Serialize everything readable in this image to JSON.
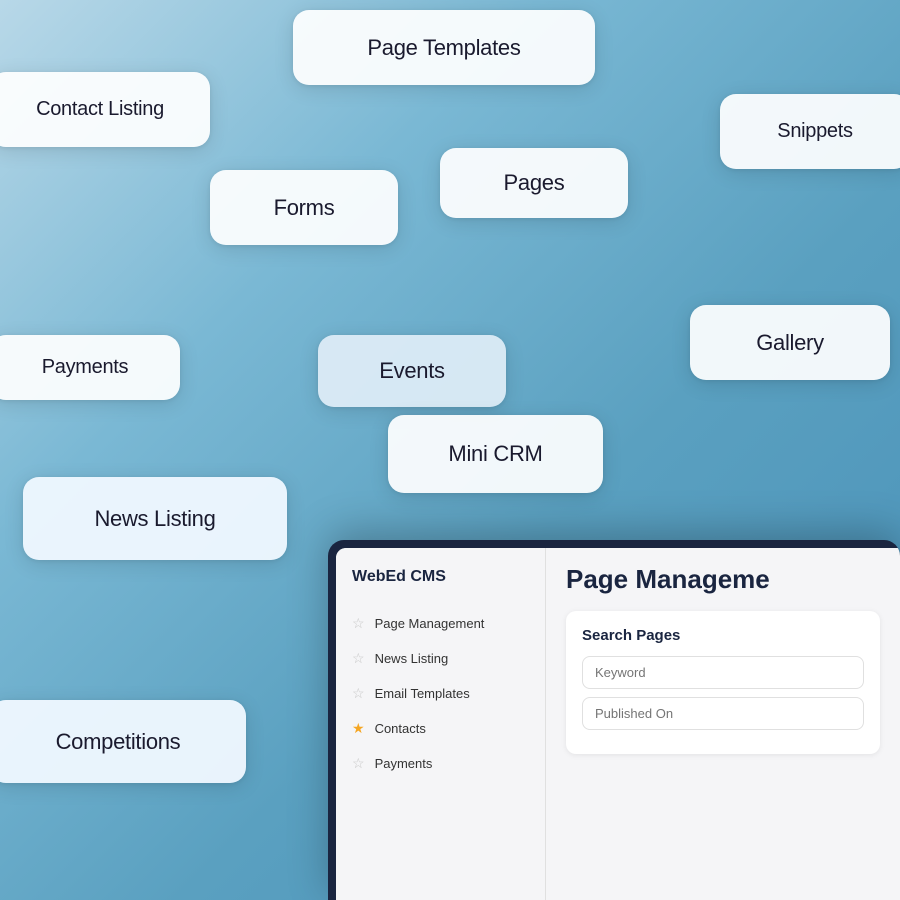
{
  "background": {
    "color_start": "#b8d8e8",
    "color_end": "#4890b8"
  },
  "cards": {
    "page_templates": "Page Templates",
    "contact_listing": "Contact Listing",
    "snippets": "Snippets",
    "pages": "Pages",
    "forms": "Forms",
    "payments": "Payments",
    "gallery": "Gallery",
    "events": "Events",
    "mini_crm": "Mini CRM",
    "news_listing": "News Listing",
    "competitions": "Competitions"
  },
  "app": {
    "logo": "WebEd CMS",
    "main_title": "Page Manageme",
    "sidebar_items": [
      {
        "label": "Page Management",
        "starred": false
      },
      {
        "label": "News Listing",
        "starred": false
      },
      {
        "label": "Email Templates",
        "starred": false
      },
      {
        "label": "Contacts",
        "starred": true
      },
      {
        "label": "Payments",
        "starred": false
      }
    ],
    "search_panel": {
      "title": "Search Pages",
      "keyword_placeholder": "Keyword",
      "published_placeholder": "Published On"
    }
  }
}
